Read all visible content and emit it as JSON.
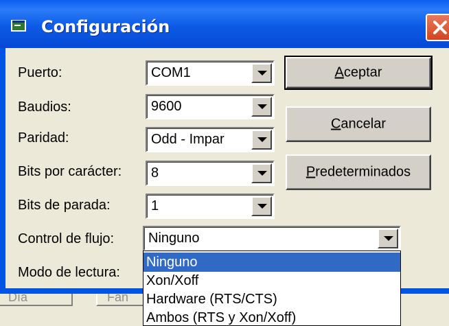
{
  "background": {
    "buttons": [
      "Día",
      "Fan"
    ]
  },
  "dialog": {
    "title": "Configuración",
    "title_icon": "window-icon",
    "close_icon": "close-icon"
  },
  "fields": [
    {
      "label": "Puerto:",
      "value": "COM1"
    },
    {
      "label": "Baudios:",
      "value": "9600"
    },
    {
      "label": "Paridad:",
      "value": "Odd - Impar"
    },
    {
      "label": "Bits por carácter:",
      "value": "8"
    },
    {
      "label": "Bits de parada:",
      "value": "1"
    },
    {
      "label": "Control de flujo:",
      "value": "Ninguno"
    },
    {
      "label": "Modo de lectura:",
      "value": ""
    }
  ],
  "buttons": {
    "aceptar": {
      "accel": "A",
      "rest": "ceptar"
    },
    "cancelar": {
      "accel": "C",
      "rest": "ancelar"
    },
    "predeterminados": {
      "accel": "P",
      "rest": "redeterminados"
    }
  },
  "dropdown": {
    "options": [
      "Ninguno",
      "Xon/Xoff",
      "Hardware (RTS/CTS)",
      "Ambos (RTS y Xon/Xoff)"
    ],
    "selected": "Ninguno",
    "highlight_color": "#316ac5"
  }
}
